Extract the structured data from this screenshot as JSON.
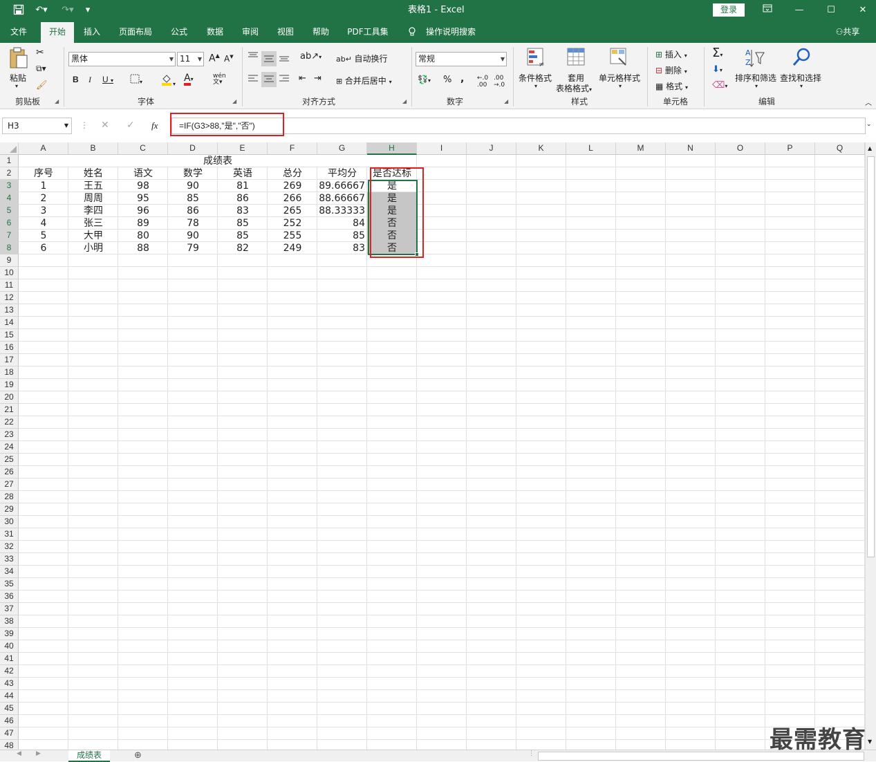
{
  "titlebar": {
    "title": "表格1  -  Excel",
    "login": "登录",
    "qat_icons": [
      "save-icon",
      "undo-icon",
      "redo-icon",
      "customize-qat-icon"
    ]
  },
  "tabs": [
    "文件",
    "开始",
    "插入",
    "页面布局",
    "公式",
    "数据",
    "审阅",
    "视图",
    "帮助",
    "PDF工具集"
  ],
  "tell_me": "操作说明搜索",
  "share": "共享",
  "ribbon": {
    "clipboard": {
      "paste": "粘贴",
      "label": "剪贴板"
    },
    "font": {
      "name": "黑体",
      "size": "11",
      "bold": "B",
      "italic": "I",
      "underline": "U",
      "grow": "A",
      "shrink": "A",
      "color_a": "A",
      "phonetic": "wén",
      "label": "字体",
      "font_color": "#e02020",
      "fill_color": "#ffd800"
    },
    "alignment": {
      "wrap": "自动换行",
      "merge": "合并后居中",
      "label": "对齐方式"
    },
    "number": {
      "format": "常规",
      "percent": "%",
      "comma": ",",
      "label": "数字"
    },
    "styles": {
      "conditional": "条件格式",
      "table1": "套用",
      "table2": "表格格式",
      "cell_styles": "单元格样式",
      "label": "样式"
    },
    "cells": {
      "insert": "插入",
      "delete": "删除",
      "format": "格式",
      "label": "单元格"
    },
    "editing": {
      "sum": "Σ",
      "sort": "排序和筛选",
      "find": "查找和选择",
      "label": "编辑"
    }
  },
  "formula_bar": {
    "name_box": "H3",
    "fx": "fx",
    "formula": "=IF(G3>88,\"是\",\"否\")"
  },
  "columns": [
    "A",
    "B",
    "C",
    "D",
    "E",
    "F",
    "G",
    "H",
    "I",
    "J",
    "K",
    "L",
    "M",
    "N",
    "O",
    "P",
    "Q"
  ],
  "rows": [
    "1",
    "2",
    "3",
    "4",
    "5",
    "6",
    "7",
    "8",
    "9",
    "10",
    "11",
    "12",
    "13",
    "14",
    "15",
    "16",
    "17",
    "18",
    "19",
    "20",
    "21",
    "22",
    "23",
    "24",
    "25",
    "26",
    "27",
    "28",
    "29",
    "30",
    "31",
    "32",
    "33",
    "34",
    "35",
    "36",
    "37",
    "38",
    "39",
    "40",
    "41",
    "42",
    "43",
    "44",
    "45",
    "46",
    "47",
    "48"
  ],
  "sheet": {
    "title": "成绩表",
    "headers": [
      "序号",
      "姓名",
      "语文",
      "数学",
      "英语",
      "总分",
      "平均分",
      "是否达标"
    ],
    "data": [
      [
        "1",
        "王五",
        "98",
        "90",
        "81",
        "269",
        "89.66667",
        "是"
      ],
      [
        "2",
        "周周",
        "95",
        "85",
        "86",
        "266",
        "88.66667",
        "是"
      ],
      [
        "3",
        "李四",
        "96",
        "86",
        "83",
        "265",
        "88.33333",
        "是"
      ],
      [
        "4",
        "张三",
        "89",
        "78",
        "85",
        "252",
        "84",
        "否"
      ],
      [
        "5",
        "大甲",
        "80",
        "90",
        "85",
        "255",
        "85",
        "否"
      ],
      [
        "6",
        "小明",
        "88",
        "79",
        "82",
        "249",
        "83",
        "否"
      ]
    ]
  },
  "sheet_tab": "成绩表",
  "watermark": "最需教育"
}
